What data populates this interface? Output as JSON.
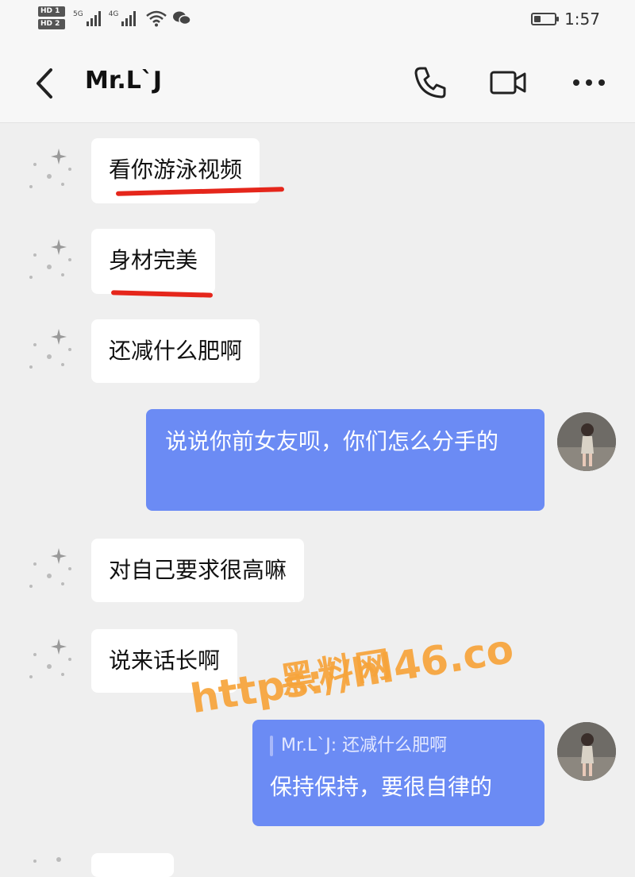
{
  "status_bar": {
    "sim1": "HD 1",
    "sim2": "HD 2",
    "net1": "5G",
    "net2": "4G",
    "battery_level": 0.35,
    "time": "1:57"
  },
  "header": {
    "title": "Mr.L`J",
    "icons": [
      "back-chevron-icon",
      "phone-icon",
      "video-call-icon",
      "more-icon"
    ]
  },
  "messages": [
    {
      "side": "left",
      "text": "看你游泳视频",
      "underlined": true
    },
    {
      "side": "left",
      "text": "身材完美",
      "underlined": true
    },
    {
      "side": "left",
      "text": "还减什么肥啊"
    },
    {
      "side": "right",
      "text": "说说你前女友呗，你们怎么分手的"
    },
    {
      "side": "left",
      "text": "对自己要求很高嘛"
    },
    {
      "side": "left",
      "text": "说来话长啊"
    },
    {
      "side": "right",
      "quote": "Mr.L`J: 还减什么肥啊",
      "text": "保持保持，要很自律的"
    }
  ],
  "watermark": {
    "line1": "黑料网",
    "line2": "https://hl46.co"
  },
  "colors": {
    "sent_bubble": "#6b8bf4",
    "received_bubble": "#ffffff",
    "background": "#efefef",
    "underline": "#e5261b",
    "watermark": "#f7a43a"
  }
}
